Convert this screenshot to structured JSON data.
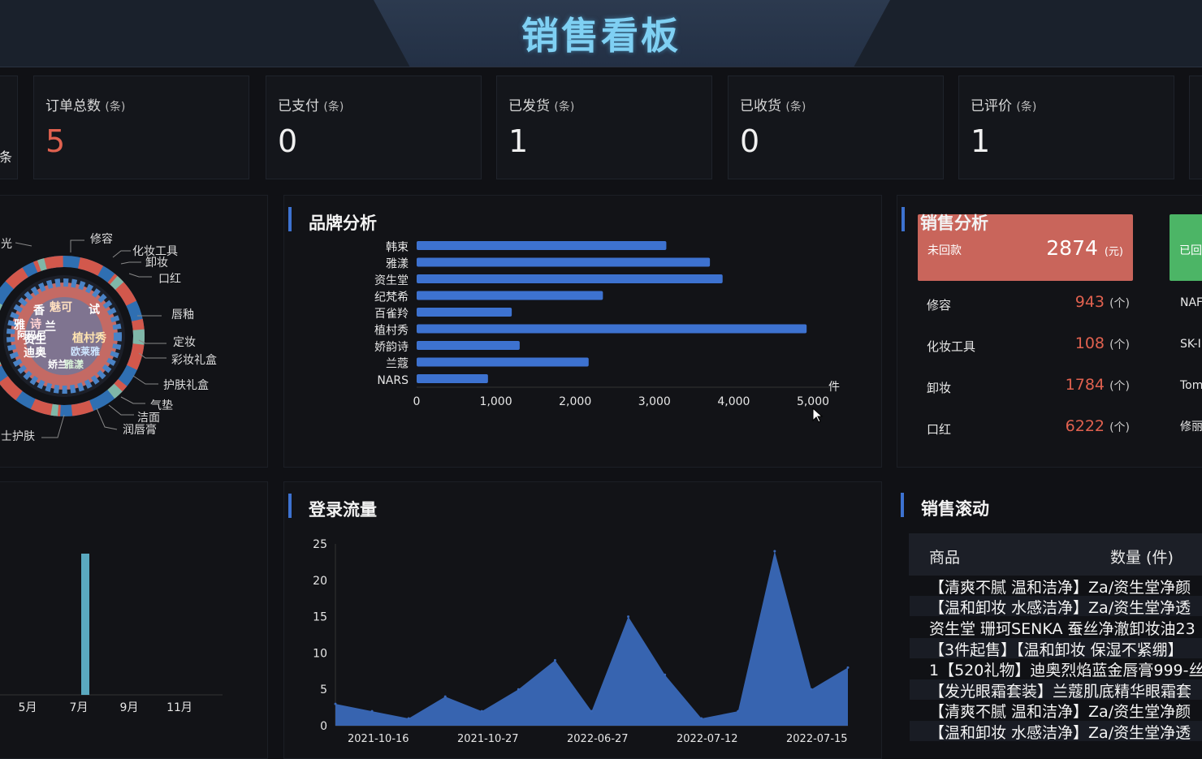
{
  "header": {
    "title": "销售看板"
  },
  "cards": [
    {
      "label": "订单总数",
      "unit": "(条)",
      "value": "5",
      "color": "#e0614f"
    },
    {
      "label": "已支付",
      "unit": "(条)",
      "value": "0"
    },
    {
      "label": "已发货",
      "unit": "(条)",
      "value": "1"
    },
    {
      "label": "已收货",
      "unit": "(条)",
      "value": "0"
    },
    {
      "label": "已评价",
      "unit": "(条)",
      "value": "1"
    }
  ],
  "left_partial": {
    "card_unit_fragment": "条"
  },
  "donut": {
    "labels": [
      "光",
      "修容",
      "化妆工具",
      "卸妆",
      "口红",
      "唇釉",
      "定妆",
      "彩妆礼盒",
      "护肤礼盒",
      "气垫",
      "洁面",
      "润唇膏",
      "士护肤"
    ],
    "word_cloud": [
      "香",
      "魅可",
      "试",
      "雅",
      "诗",
      "兰",
      "植村秀",
      "资生",
      "阿玛尼",
      "欧莱雅",
      "迪奥",
      "娇兰",
      "雅漾"
    ]
  },
  "brand": {
    "title": "品牌分析",
    "chart_data": {
      "type": "bar",
      "orientation": "horizontal",
      "categories": [
        "韩束",
        "雅漾",
        "资生堂",
        "纪梵希",
        "百雀羚",
        "植村秀",
        "娇韵诗",
        "兰蔻",
        "NARS"
      ],
      "values": [
        3150,
        3700,
        3860,
        2350,
        1200,
        4920,
        1300,
        2170,
        900
      ],
      "xlim": [
        0,
        5000
      ],
      "xticks": [
        "0",
        "1,000",
        "2,000",
        "3,000",
        "4,000",
        "5,000"
      ],
      "unit": "件",
      "color": "#3d72d0"
    }
  },
  "sales": {
    "title": "销售分析",
    "unpaid": {
      "label": "未回款",
      "value": "2874",
      "unit": "(元)",
      "color": "#c9655b"
    },
    "paid_fragment": "已回",
    "rows": [
      {
        "label": "修容",
        "value": "943",
        "unit": "(个)"
      },
      {
        "label": "化妆工具",
        "value": "108",
        "unit": "(个)"
      },
      {
        "label": "卸妆",
        "value": "1784",
        "unit": "(个)"
      },
      {
        "label": "口红",
        "value": "6222",
        "unit": "(个)"
      }
    ],
    "right_fragments": [
      "NAF",
      "SK-I",
      "Tom",
      "修丽"
    ]
  },
  "monthly": {
    "chart_data": {
      "type": "bar",
      "categories": [
        "5月",
        "7月",
        "9月",
        "11月"
      ],
      "values": [
        0,
        24,
        0,
        0
      ],
      "color": "#5aa9c0"
    }
  },
  "traffic": {
    "title": "登录流量",
    "chart_data": {
      "type": "area",
      "y": [
        3,
        2,
        1,
        4,
        2,
        5,
        9,
        2,
        15,
        7,
        1,
        2,
        24,
        5,
        8
      ],
      "ylim": [
        0,
        25
      ],
      "yticks": [
        "0",
        "5",
        "10",
        "15",
        "20",
        "25"
      ],
      "xticks": [
        "2021-10-16",
        "2021-10-27",
        "2022-06-27",
        "2022-07-12",
        "2022-07-15"
      ],
      "color": "#3a68b8"
    }
  },
  "scroll": {
    "title": "销售滚动",
    "col_product": "商品",
    "col_qty": "数量 (件)",
    "rows": [
      "【清爽不腻 温和洁净】Za/资生堂净颜",
      "【温和卸妆 水感洁净】Za/资生堂净透",
      "资生堂 珊珂SENKA 蚕丝净澈卸妆油23",
      "【3件起售】【温和卸妆 保湿不紧绷】",
      "1【520礼物】迪奥烈焰蓝金唇膏999-丝",
      "【发光眼霜套装】兰蔻肌底精华眼霜套",
      "【清爽不腻 温和洁净】Za/资生堂净颜",
      "【温和卸妆 水感洁净】Za/资生堂净透"
    ]
  }
}
